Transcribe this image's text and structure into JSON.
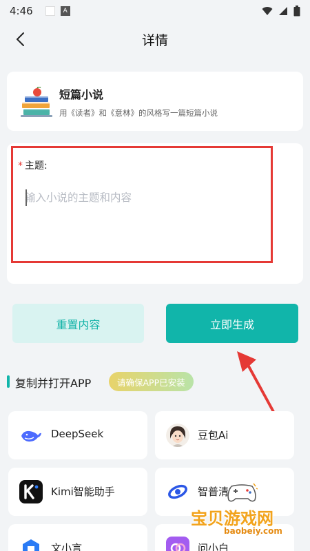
{
  "status": {
    "time": "4:46"
  },
  "header": {
    "title": "详情"
  },
  "info": {
    "title": "短篇小说",
    "description": "用《读者》和《意林》的风格写一篇短篇小说"
  },
  "form": {
    "required_mark": "*",
    "topic_label": "主题:",
    "topic_placeholder": "输入小说的主题和内容",
    "topic_value": ""
  },
  "buttons": {
    "reset_label": "重置内容",
    "generate_label": "立即生成"
  },
  "section": {
    "title": "复制并打开APP",
    "badge": "请确保APP已安装"
  },
  "apps": [
    {
      "label": "DeepSeek",
      "icon": "deepseek-whale-icon"
    },
    {
      "label": "豆包Ai",
      "icon": "doubao-avatar-icon"
    },
    {
      "label": "Kimi智能助手",
      "icon": "kimi-k-icon"
    },
    {
      "label": "智普清言",
      "icon": "zhipu-ring-icon"
    },
    {
      "label": "文小言",
      "icon": "wenxiaoyan-icon"
    },
    {
      "label": "问小白",
      "icon": "wenxiaobai-icon"
    }
  ],
  "watermark": {
    "text": "宝贝游戏网",
    "url": "baobeiy.com"
  },
  "colors": {
    "accent": "#11b5aa",
    "accent_light": "#d9f3f1",
    "highlight": "#e53935",
    "background": "#f2f4f6"
  }
}
